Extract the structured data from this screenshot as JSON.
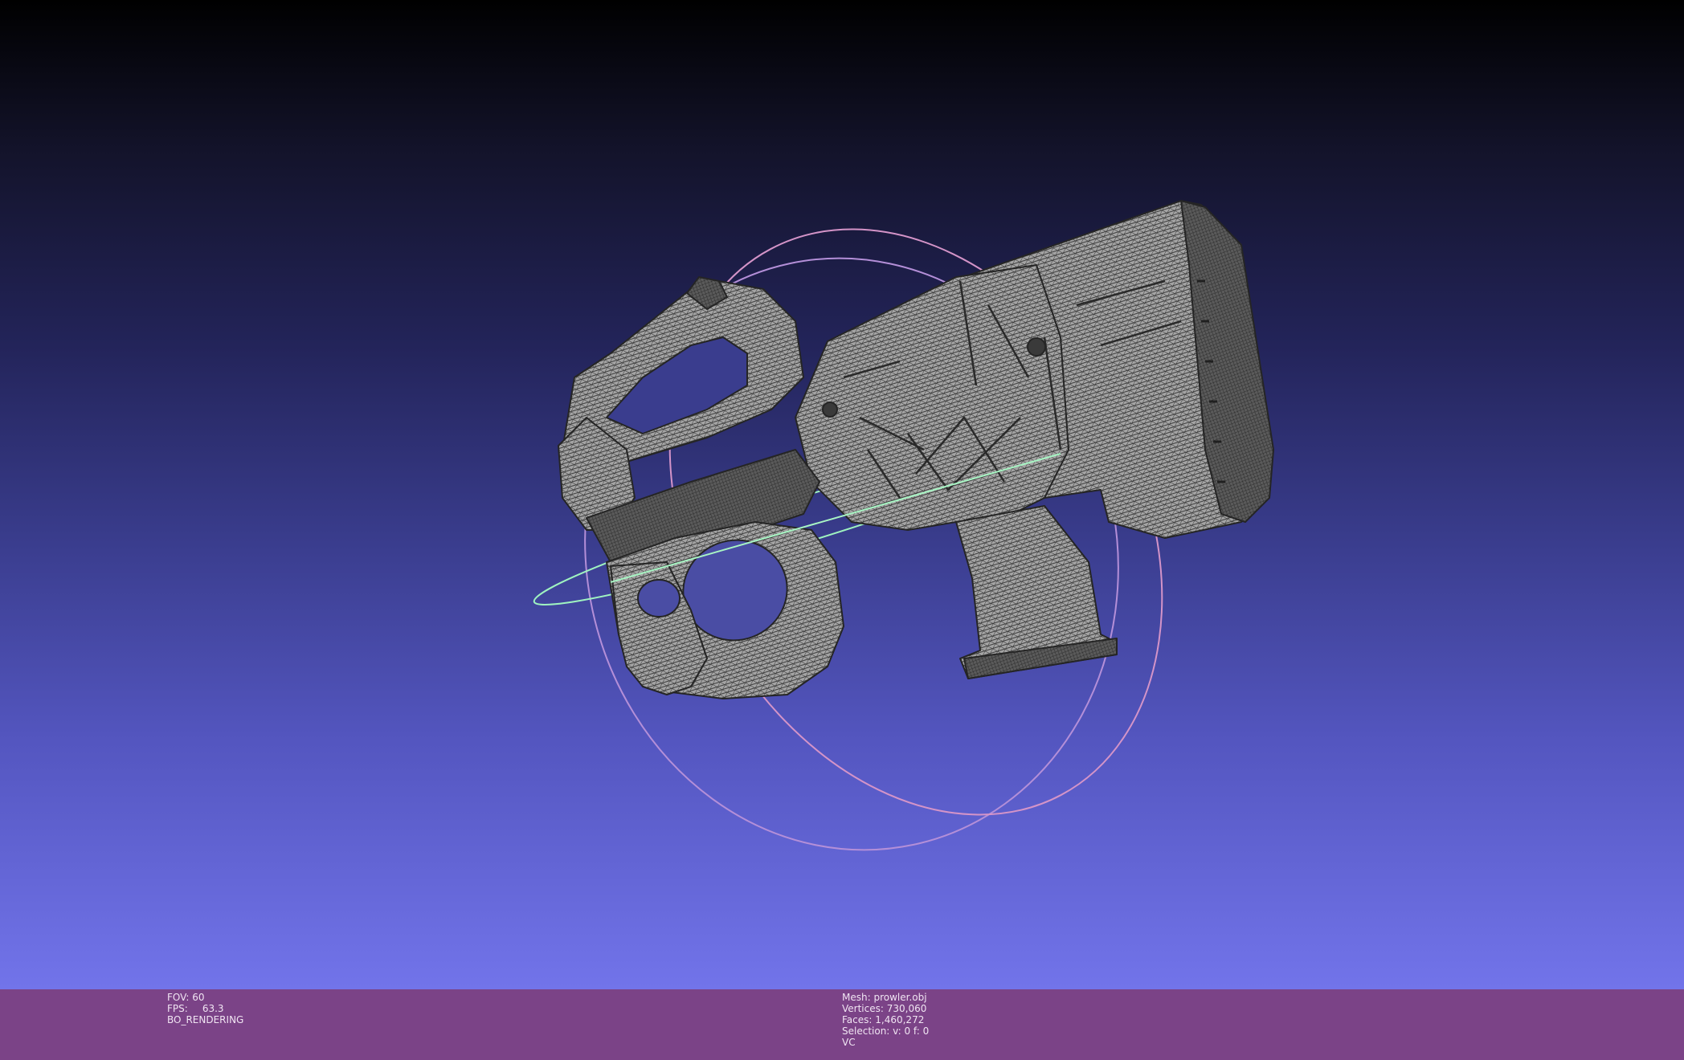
{
  "viewport": {
    "background_top": "#000000",
    "background_bottom": "#7274ea",
    "mesh_color": "#9a9a9a",
    "wire_color": "#2e2e2e",
    "trackball": {
      "x_ring_color": "#8ff0b0",
      "y_ring_color": "#c79ae0",
      "z_ring_color": "#d89ac8"
    }
  },
  "status_bar": {
    "background": "#7b4387",
    "render_info": {
      "fov_label": "FOV:",
      "fov_value": "60",
      "fps_label": "FPS:",
      "fps_value": "63.3",
      "render_mode": "BO_RENDERING"
    },
    "mesh_info": {
      "mesh_label": "Mesh:",
      "mesh_value": "prowler.obj",
      "vertices_label": "Vertices:",
      "vertices_value": "730,060",
      "faces_label": "Faces:",
      "faces_value": "1,460,272",
      "selection_label": "Selection:",
      "selection_value": "v: 0 f: 0",
      "color_mode": "VC"
    }
  }
}
